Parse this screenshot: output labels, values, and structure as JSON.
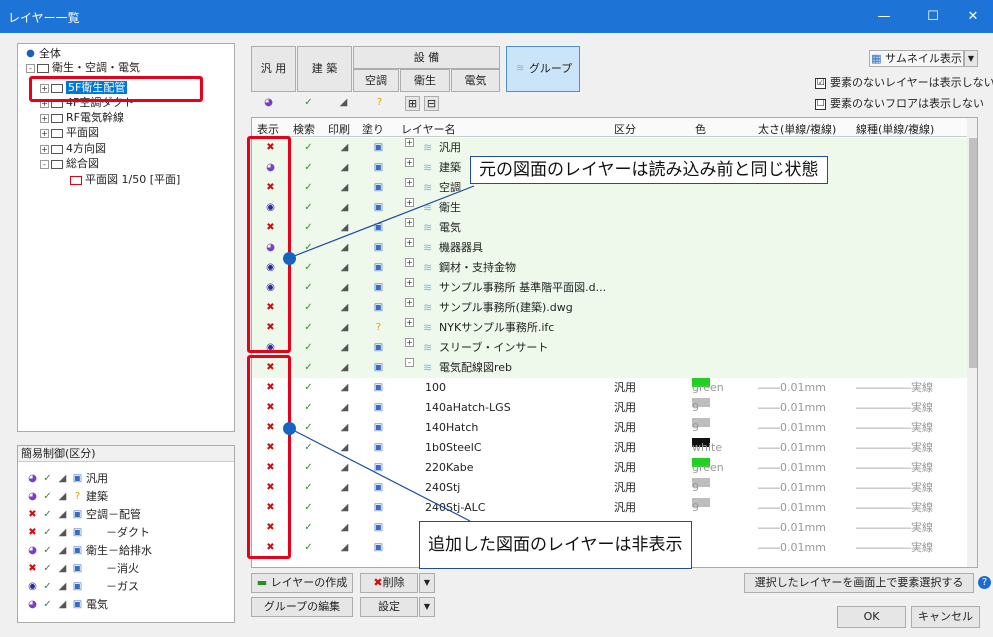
{
  "window": {
    "title": "レイヤー一覧",
    "min": "—",
    "max": "☐",
    "close": "✕"
  },
  "tree": {
    "root": "全体",
    "items": [
      "衛生・空調・電気",
      "5F衛生配管",
      "4F空調ダクト",
      "RF電気幹線",
      "平面図",
      "4方向図",
      "総合図",
      "平面図 1/50 [平面]"
    ]
  },
  "simple": {
    "title": "簡易制御(区分)",
    "rows": [
      "汎用",
      "建築",
      "空調－配管",
      "－ダクト",
      "衛生－給排水",
      "－消火",
      "－ガス",
      "電気"
    ]
  },
  "tabs": {
    "general": "汎 用",
    "arch": "建 築",
    "equip": "設 備",
    "hvac": "空調",
    "sanitary": "衛生",
    "electric": "電気",
    "group": "グループ",
    "expand": "⊞",
    "collapse": "⊟"
  },
  "options": {
    "thumb": "サムネイル表示",
    "dd": "▼",
    "opt1": "要素のないレイヤーは表示しない",
    "opt2": "要素のないフロアは表示しない",
    "opt1_checked": "☑",
    "opt2_checked": "☐"
  },
  "headers": [
    "表示",
    "検索",
    "印刷",
    "塗り",
    "レイヤー名",
    "区分",
    "色",
    "太さ(単線/複線)",
    "線種(単線/複線)"
  ],
  "groups": [
    "汎用",
    "建築",
    "空調",
    "衛生",
    "電気",
    "機器器具",
    "鋼材・支持金物",
    "サンプル事務所 基準階平面図.d...",
    "サンプル事務所(建築).dwg",
    "NYKサンプル事務所.ifc",
    "スリーブ・インサート",
    "電気配線図reb"
  ],
  "layers": [
    {
      "name": "100",
      "kubun": "汎用",
      "color": "green",
      "hex": "#22d022",
      "w": "0.01mm",
      "lt": "実線"
    },
    {
      "name": "140aHatch-LGS",
      "kubun": "汎用",
      "color": "9",
      "hex": "#bdbdbd",
      "w": "0.01mm",
      "lt": "実線"
    },
    {
      "name": "140Hatch",
      "kubun": "汎用",
      "color": "9",
      "hex": "#bdbdbd",
      "w": "0.01mm",
      "lt": "実線"
    },
    {
      "name": "1b0SteelC",
      "kubun": "汎用",
      "color": "white",
      "hex": "#111111",
      "w": "0.01mm",
      "lt": "実線"
    },
    {
      "name": "220Kabe",
      "kubun": "汎用",
      "color": "green",
      "hex": "#22d022",
      "w": "0.01mm",
      "lt": "実線"
    },
    {
      "name": "240Stj",
      "kubun": "汎用",
      "color": "9",
      "hex": "#bdbdbd",
      "w": "0.01mm",
      "lt": "実線"
    },
    {
      "name": "240Stj-ALC",
      "kubun": "汎用",
      "color": "9",
      "hex": "#bdbdbd",
      "w": "0.01mm",
      "lt": "実線"
    },
    {
      "name": "",
      "kubun": "",
      "color": "",
      "hex": "",
      "w": "0.01mm",
      "lt": "実線"
    },
    {
      "name": "",
      "kubun": "",
      "color": "",
      "hex": "",
      "w": "0.01mm",
      "lt": "実線"
    }
  ],
  "callouts": {
    "top": "元の図面のレイヤーは読み込み前と同じ状態",
    "bottom": "追加した図面のレイヤーは非表示"
  },
  "bottom": {
    "create": "レイヤーの作成",
    "delete": "削除",
    "groupedit": "グループの編集",
    "settings": "設定",
    "selectlayer": "選択したレイヤーを画面上で要素選択する",
    "ok": "OK",
    "cancel": "キャンセル",
    "dd": "▼"
  }
}
